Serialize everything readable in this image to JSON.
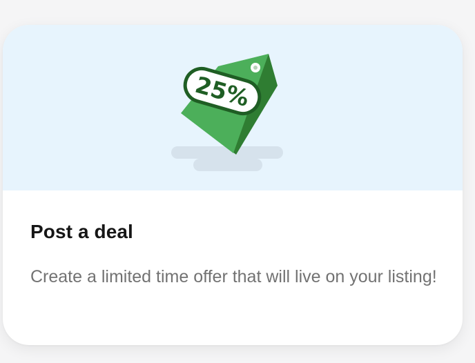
{
  "card": {
    "title": "Post a deal",
    "description": "Create a limited time offer that will live on your listing!"
  },
  "illustration": {
    "icon": "price-tag-icon",
    "tag_label": "25%",
    "colors": {
      "hero_background": "#e7f4fd",
      "tag_light": "#4caf5a",
      "tag_dark": "#2f7d32",
      "tag_label": "#1f5e24",
      "shadow": "#d6e2ec"
    }
  }
}
